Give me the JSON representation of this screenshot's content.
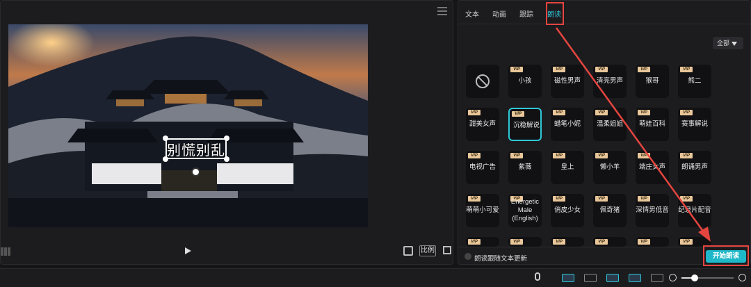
{
  "preview": {
    "caption_text": "别慌别乱",
    "ratio_label": "比例"
  },
  "panel": {
    "tabs": [
      "文本",
      "动画",
      "跟踪",
      "朗读"
    ],
    "active_tab": "朗读",
    "filter_label": "全部",
    "vip_badge": "VIP",
    "voices": [
      {
        "label": "",
        "vip": false,
        "icon": "none-icon"
      },
      {
        "label": "小孩",
        "vip": true
      },
      {
        "label": "磁性男声",
        "vip": true
      },
      {
        "label": "清亮男声",
        "vip": true
      },
      {
        "label": "猴哥",
        "vip": true
      },
      {
        "label": "熊二",
        "vip": true
      },
      {
        "label": "甜美女声",
        "vip": true
      },
      {
        "label": "沉稳解说",
        "vip": true,
        "selected": true
      },
      {
        "label": "蜡笔小妮",
        "vip": true
      },
      {
        "label": "温柔姐姐",
        "vip": true
      },
      {
        "label": "萌娃百科",
        "vip": true
      },
      {
        "label": "赛事解说",
        "vip": true
      },
      {
        "label": "电视广告",
        "vip": true
      },
      {
        "label": "紫薇",
        "vip": true
      },
      {
        "label": "皇上",
        "vip": true
      },
      {
        "label": "懒小羊",
        "vip": true
      },
      {
        "label": "端庄女声",
        "vip": true
      },
      {
        "label": "朗诵男声",
        "vip": true
      },
      {
        "label": "萌萌小可爱",
        "vip": true
      },
      {
        "label": "Energetic Male (English)",
        "vip": true
      },
      {
        "label": "俏皮少女",
        "vip": true
      },
      {
        "label": "佩奇猪",
        "vip": true
      },
      {
        "label": "深情男低音",
        "vip": true
      },
      {
        "label": "纪录片配音",
        "vip": true
      }
    ],
    "follow_text_label": "朗读跟随文本更新",
    "start_button": "开始朗读"
  },
  "colors": {
    "accent": "#2fc8d8",
    "highlight": "#e5453f",
    "vip_badge": "#e9c79a"
  },
  "timeline_zoom": 0.25
}
